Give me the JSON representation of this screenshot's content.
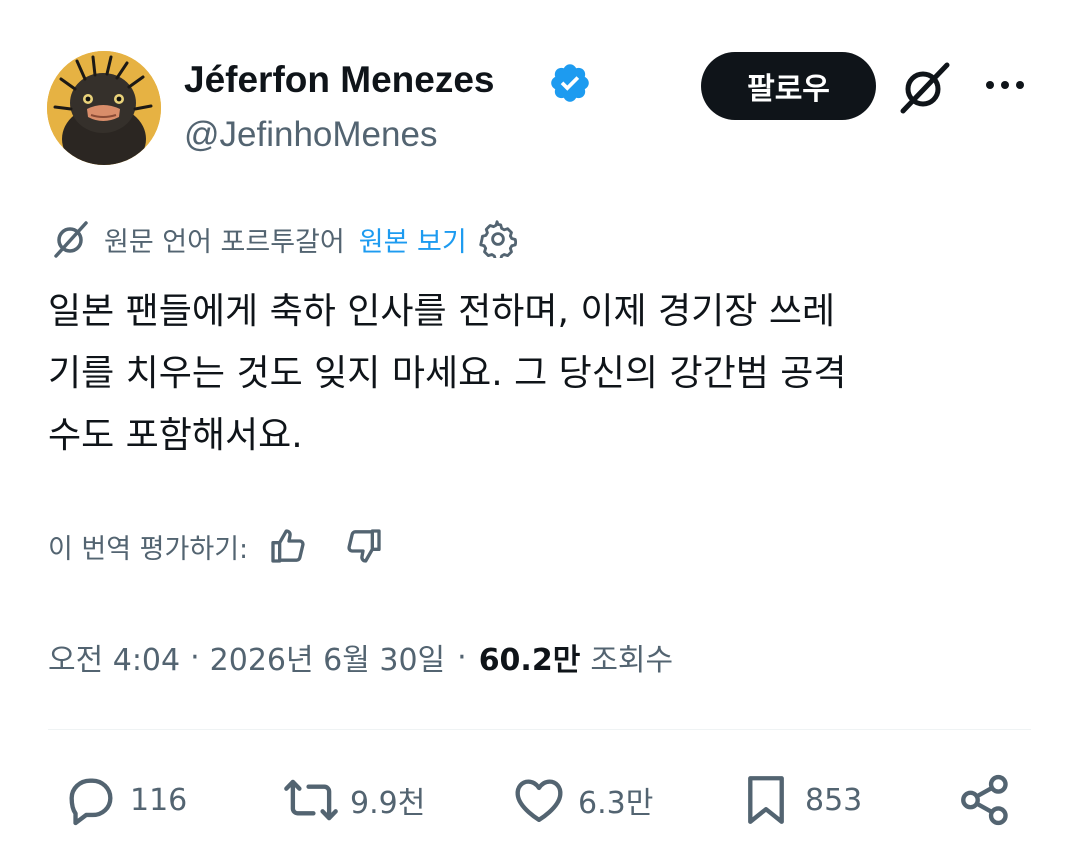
{
  "author": {
    "name": "Jéferfon Menezes",
    "handle": "@JefinhoMenes",
    "verified_icon": "verified-badge-icon",
    "avatar": "emu-avatar"
  },
  "header_actions": {
    "follow_label": "팔로우",
    "grok_icon": "grok-icon",
    "more_icon": "more-icon"
  },
  "translation": {
    "source_label": "원문 언어 포르투갈어",
    "show_original": "원본 보기",
    "settings_icon": "gear-icon"
  },
  "tweet": {
    "lines": [
      "일본 팬들에게 축하 인사를 전하며, 이제 경기장 쓰레",
      "기를 치우는 것도 잊지 마세요. 그 당신의 강간범 공격",
      "수도 포함해서요."
    ]
  },
  "rating": {
    "label": "이 번역 평가하기:"
  },
  "meta": {
    "time": "오전 4:04",
    "sep1": "·",
    "date": "2026년 6월 30일",
    "sep2": "·",
    "views_count": "60.2만",
    "views_label": "조회수"
  },
  "actions": {
    "replies": "116",
    "reposts": "9.9천",
    "likes": "6.3만",
    "bookmarks": "853"
  },
  "colors": {
    "text": "#0f1419",
    "secondary": "#536471",
    "accent": "#1d9bf0",
    "follow_bg": "#0f1419"
  }
}
